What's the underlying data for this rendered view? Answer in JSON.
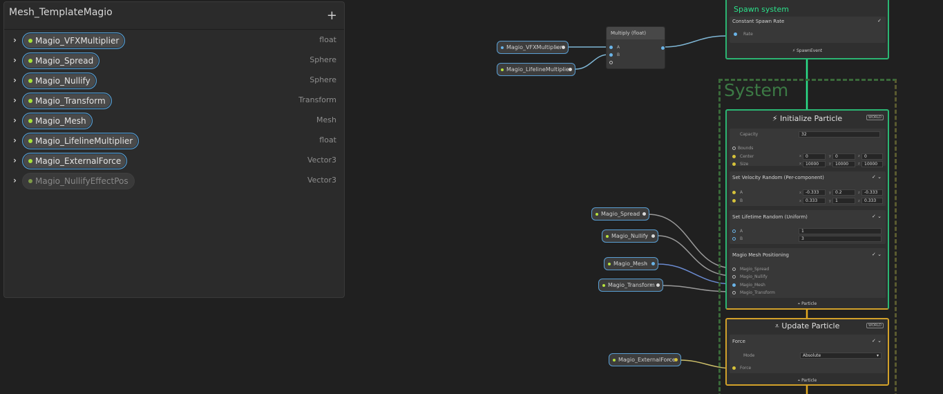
{
  "blackboard": {
    "title": "Mesh_TemplateMagio",
    "add": "+",
    "properties": [
      {
        "name": "Magio_VFXMultiplier",
        "type": "float",
        "active": true
      },
      {
        "name": "Magio_Spread",
        "type": "Sphere",
        "active": true
      },
      {
        "name": "Magio_Nullify",
        "type": "Sphere",
        "active": true
      },
      {
        "name": "Magio_Transform",
        "type": "Transform",
        "active": true
      },
      {
        "name": "Magio_Mesh",
        "type": "Mesh",
        "active": true
      },
      {
        "name": "Magio_LifelineMultiplier",
        "type": "float",
        "active": true
      },
      {
        "name": "Magio_ExternalForce",
        "type": "Vector3",
        "active": true
      },
      {
        "name": "Magio_NullifyEffectPos",
        "type": "Vector3",
        "active": false
      }
    ]
  },
  "graph_nodes": {
    "vfx_multiplier": "Magio_VFXMultiplier",
    "lifeline_multiplier": "Magio_LifelineMultiplier",
    "spread": "Magio_Spread",
    "nullify": "Magio_Nullify",
    "mesh": "Magio_Mesh",
    "transform": "Magio_Transform",
    "external_force": "Magio_ExternalForce",
    "arrow": "‹"
  },
  "multiply": {
    "title": "Multiply (float)",
    "a": "A",
    "b": "B"
  },
  "spawn": {
    "title": "Spawn system",
    "block": "Constant Spawn Rate",
    "rate": "Rate",
    "event": "SpawnEvent"
  },
  "system": {
    "label": "System"
  },
  "init": {
    "title": "Initialize Particle",
    "world": "WORLD",
    "capacity_label": "Capacity",
    "capacity": "32",
    "bounds": "Bounds",
    "center": "Center",
    "size": "Size",
    "center_x": "0",
    "center_y": "0",
    "center_z": "0",
    "size_x": "10000",
    "size_y": "10000",
    "size_z": "10000",
    "velocity_block": "Set Velocity Random (Per-component)",
    "a": "A",
    "b": "B",
    "va_x": "-0.333",
    "va_y": "0.2",
    "va_z": "-0.333",
    "vb_x": "0.333",
    "vb_y": "1",
    "vb_z": "0.333",
    "lifetime_block": "Set Lifetime Random (Uniform)",
    "la": "1",
    "lb": "3",
    "mesh_block": "Magio Mesh Positioning",
    "m_spread": "Magio_Spread",
    "m_nullify": "Magio_Nullify",
    "m_mesh": "Magio_Mesh",
    "m_transform": "Magio_Transform",
    "footer": "Particle"
  },
  "update": {
    "title": "Update Particle",
    "world": "WORLD",
    "force_block": "Force",
    "mode_label": "Mode",
    "mode": "Absolute",
    "force_label": "Force",
    "footer": "Particle"
  },
  "axis": {
    "x": "x",
    "y": "y",
    "z": "z"
  },
  "colors": {
    "accent_blue": "#5ea8dd",
    "spawn_green": "#2bb673",
    "update_yellow": "#d3a22a",
    "float_dot": "#a7e33a"
  }
}
